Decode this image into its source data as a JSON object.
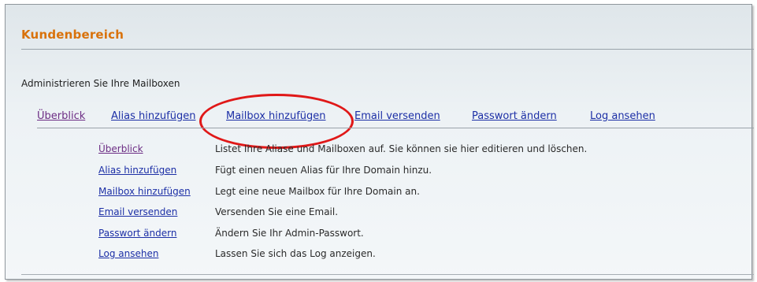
{
  "header": {
    "title": "Kundenbereich"
  },
  "intro_text": "Administrieren Sie Ihre Mailboxen",
  "nav": [
    {
      "label": "Überblick"
    },
    {
      "label": "Alias hinzufügen"
    },
    {
      "label": "Mailbox hinzufügen"
    },
    {
      "label": "Email versenden"
    },
    {
      "label": "Passwort ändern"
    },
    {
      "label": "Log ansehen"
    }
  ],
  "overview": [
    {
      "link": "Überblick",
      "desc": "Listet Ihre Aliase und Mailboxen auf. Sie können sie hier editieren und löschen."
    },
    {
      "link": "Alias hinzufügen",
      "desc": "Fügt einen neuen Alias für Ihre Domain hinzu."
    },
    {
      "link": "Mailbox hinzufügen",
      "desc": "Legt eine neue Mailbox für Ihre Domain an."
    },
    {
      "link": "Email versenden",
      "desc": "Versenden Sie eine Email."
    },
    {
      "link": "Passwort ändern",
      "desc": "Ändern Sie Ihr Admin-Passwort."
    },
    {
      "link": "Log ansehen",
      "desc": "Lassen Sie sich das Log anzeigen."
    }
  ],
  "colors": {
    "title": "#d9720b",
    "link": "#1c2fa6",
    "visited_link": "#6c2d84",
    "highlight_circle": "#e01818"
  }
}
